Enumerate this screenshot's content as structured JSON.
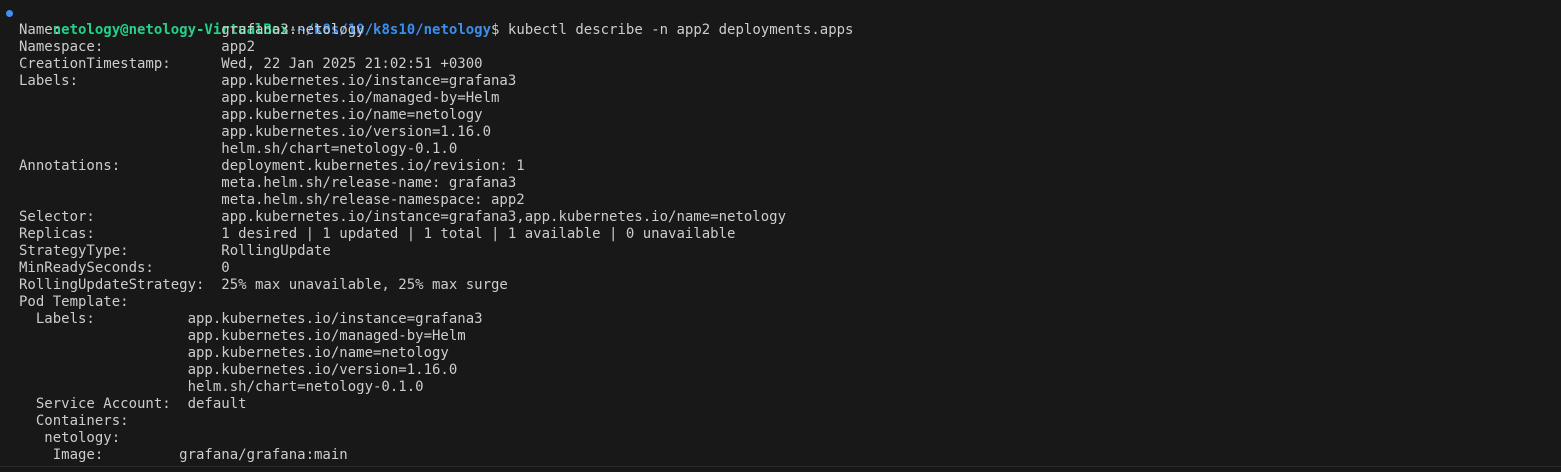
{
  "terminal": {
    "prompt": {
      "user_host": "netology@netology-VirtualBox",
      "separator": ":",
      "path": "~/k8s/10/k8s10/netology",
      "symbol": "$",
      "command": " kubectl describe -n app2 deployments.apps"
    },
    "output_lines": [
      "Name:                   grafana3-netology",
      "Namespace:              app2",
      "CreationTimestamp:      Wed, 22 Jan 2025 21:02:51 +0300",
      "Labels:                 app.kubernetes.io/instance=grafana3",
      "                        app.kubernetes.io/managed-by=Helm",
      "                        app.kubernetes.io/name=netology",
      "                        app.kubernetes.io/version=1.16.0",
      "                        helm.sh/chart=netology-0.1.0",
      "Annotations:            deployment.kubernetes.io/revision: 1",
      "                        meta.helm.sh/release-name: grafana3",
      "                        meta.helm.sh/release-namespace: app2",
      "Selector:               app.kubernetes.io/instance=grafana3,app.kubernetes.io/name=netology",
      "Replicas:               1 desired | 1 updated | 1 total | 1 available | 0 unavailable",
      "StrategyType:           RollingUpdate",
      "MinReadySeconds:        0",
      "RollingUpdateStrategy:  25% max unavailable, 25% max surge",
      "Pod Template:",
      "  Labels:           app.kubernetes.io/instance=grafana3",
      "                    app.kubernetes.io/managed-by=Helm",
      "                    app.kubernetes.io/name=netology",
      "                    app.kubernetes.io/version=1.16.0",
      "                    helm.sh/chart=netology-0.1.0",
      "  Service Account:  default",
      "  Containers:",
      "   netology:",
      "    Image:         grafana/grafana:main"
    ]
  },
  "colors": {
    "background": "#181818",
    "text": "#cccccc",
    "user_host": "#23d18b",
    "path": "#3b8eea",
    "status_dot": "#3794ff"
  }
}
